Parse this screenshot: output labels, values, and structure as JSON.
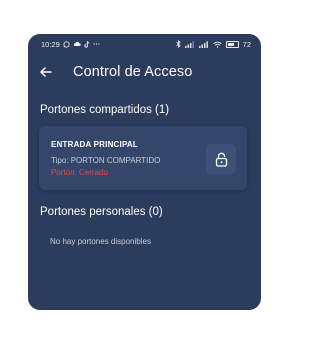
{
  "status_bar": {
    "time": "10:29",
    "left_icons": [
      "whatsapp-icon",
      "cloud-icon",
      "tiktok-icon",
      "more-dots-icon"
    ],
    "right_icons": [
      "bluetooth-icon",
      "signal-icon",
      "signal-icon",
      "wifi-icon",
      "battery-icon"
    ],
    "battery": "72",
    "battery_level": 0.72
  },
  "header": {
    "title": "Control de Acceso",
    "back_icon": "arrow-left-icon"
  },
  "shared_section": {
    "title": "Portones compartidos (1)",
    "gates": [
      {
        "name": "ENTRADA PRINCIPAL",
        "type": "Tipo: PORTON COMPARTIDO",
        "status": "Portón: Cerrado",
        "action_icon": "lock-icon"
      }
    ]
  },
  "personal_section": {
    "title": "Portones personales (0)",
    "empty_message": "No hay portones disponibles"
  },
  "colors": {
    "background": "#2b3c5c",
    "card": "#34476a",
    "status_closed": "#e04848"
  }
}
